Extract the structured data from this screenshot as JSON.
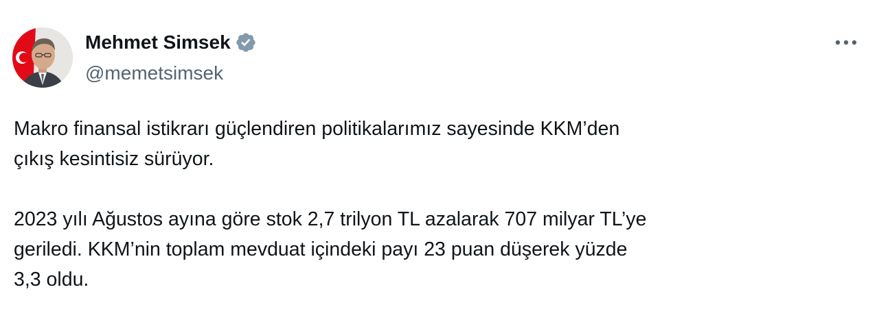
{
  "author": {
    "display_name": "Mehmet Simsek",
    "handle": "@memetsimsek",
    "verified": true
  },
  "icons": {
    "verified": "verified-badge-icon",
    "more": "more-options-icon"
  },
  "colors": {
    "text": "#0f1419",
    "secondary": "#536471",
    "verified_badge": "#829aab",
    "flag_red": "#e30a17"
  },
  "tweet": {
    "paragraph_1_line_1": "Makro finansal istikrarı güçlendiren politikalarımız sayesinde KKM’den",
    "paragraph_1_line_2": "çıkış kesintisiz sürüyor.",
    "paragraph_2_line_1": "2023 yılı Ağustos ayına göre stok 2,7 trilyon TL azalarak 707 milyar TL’ye",
    "paragraph_2_line_2": "geriledi. KKM’nin toplam mevduat içindeki payı 23 puan düşerek yüzde",
    "paragraph_2_line_3": "3,3 oldu."
  }
}
